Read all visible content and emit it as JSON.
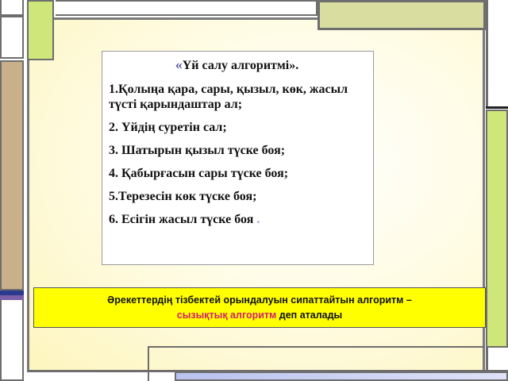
{
  "algorithm_box": {
    "title_open_quote": "«",
    "title": "Үй салу алгоритмі».",
    "steps": [
      "1.Қолыңа қара, сары, қызыл, көк, жасыл түсті қарындаштар ал;",
      "2. Үйдің суретін сал;",
      "3. Шатырын қызыл түске боя;",
      "4. Қабырғасын сары түске боя;",
      "5.Терезесін көк түске боя;",
      "6. Есігін жасыл түске боя"
    ],
    "last_step_trailing": "."
  },
  "definition_box": {
    "text_before": "Әрекеттердің тізбектей орындалуын сипаттайтын алгоритм –",
    "highlight": "сызықтық алгоритм",
    "text_after": " деп аталады",
    "highlight_color": "#d0206a",
    "background_color": "#ffff00"
  }
}
